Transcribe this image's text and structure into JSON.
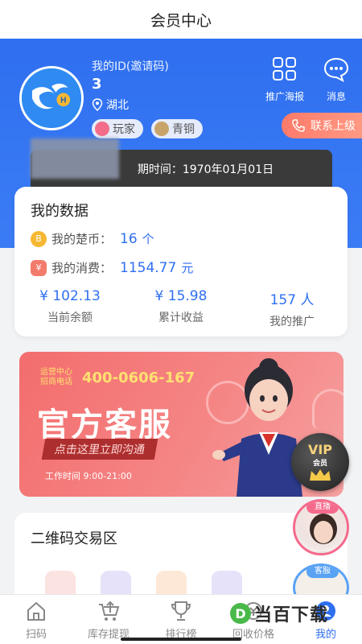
{
  "header": {
    "title": "会员中心"
  },
  "profile": {
    "id_label": "我的ID(邀请码)",
    "id_value": "3",
    "location": "湖北",
    "avatar_letter": "H",
    "badges": [
      {
        "label": "玩家",
        "color": "#f36d8a"
      },
      {
        "label": "青铜",
        "color": "#c8a46a"
      }
    ]
  },
  "top_actions": [
    {
      "label": "推广海报",
      "icon": "poster-grid-icon"
    },
    {
      "label": "消息",
      "icon": "message-bubble-icon"
    }
  ],
  "contact": {
    "label": "联系上级",
    "icon": "phone-icon"
  },
  "vip_strip": {
    "text": "期时间：1970年01月01日"
  },
  "my_data": {
    "title": "我的数据",
    "coin": {
      "label": "我的楚币：",
      "value": "16",
      "unit": "个",
      "icon_glyph": "B"
    },
    "spend": {
      "label": "我的消费：",
      "value": "1154.77",
      "unit": "元",
      "icon_glyph": "¥"
    },
    "stats": [
      {
        "value": "¥ 102.13",
        "label": "当前余额"
      },
      {
        "value": "¥ 15.98",
        "label": "累计收益"
      },
      {
        "value": "157 人",
        "label": "我的推广"
      }
    ]
  },
  "banner": {
    "line1": "运营中心",
    "line2": "招商电话",
    "phone": "400-0606-167",
    "headline": "官方客服",
    "cta": "点击这里立即沟通",
    "hours": "工作时间 9:00-21:00"
  },
  "vip_badge": {
    "text": "VIP",
    "sub": "会员"
  },
  "qr_section": {
    "title": "二维码交易区",
    "tiles": [
      {
        "icon": "red-envelope-icon",
        "color": "#fbe3e1"
      },
      {
        "icon": "clipboard-icon",
        "color": "#e6e2fa"
      },
      {
        "icon": "rocket-icon",
        "color": "#fde8d7"
      },
      {
        "icon": "document-icon",
        "color": "#e6e2fa"
      }
    ]
  },
  "live": {
    "tag": "直播"
  },
  "service_float": {
    "tag": "客服"
  },
  "tabbar": [
    {
      "label": "扫码",
      "icon": "home-icon",
      "active": false
    },
    {
      "label": "库存提现",
      "icon": "cart-upload-icon",
      "active": false
    },
    {
      "label": "排行榜",
      "icon": "trophy-icon",
      "active": false
    },
    {
      "label": "回收价格",
      "icon": "recycle-icon",
      "active": false
    },
    {
      "label": "我的",
      "icon": "user-icon",
      "active": true
    }
  ],
  "watermark": {
    "logo": "D",
    "text": "当百下载"
  },
  "colors": {
    "primary": "#2f6ff0",
    "accent_red": "#f36d6d",
    "tab_active": "#2f6ff0"
  }
}
